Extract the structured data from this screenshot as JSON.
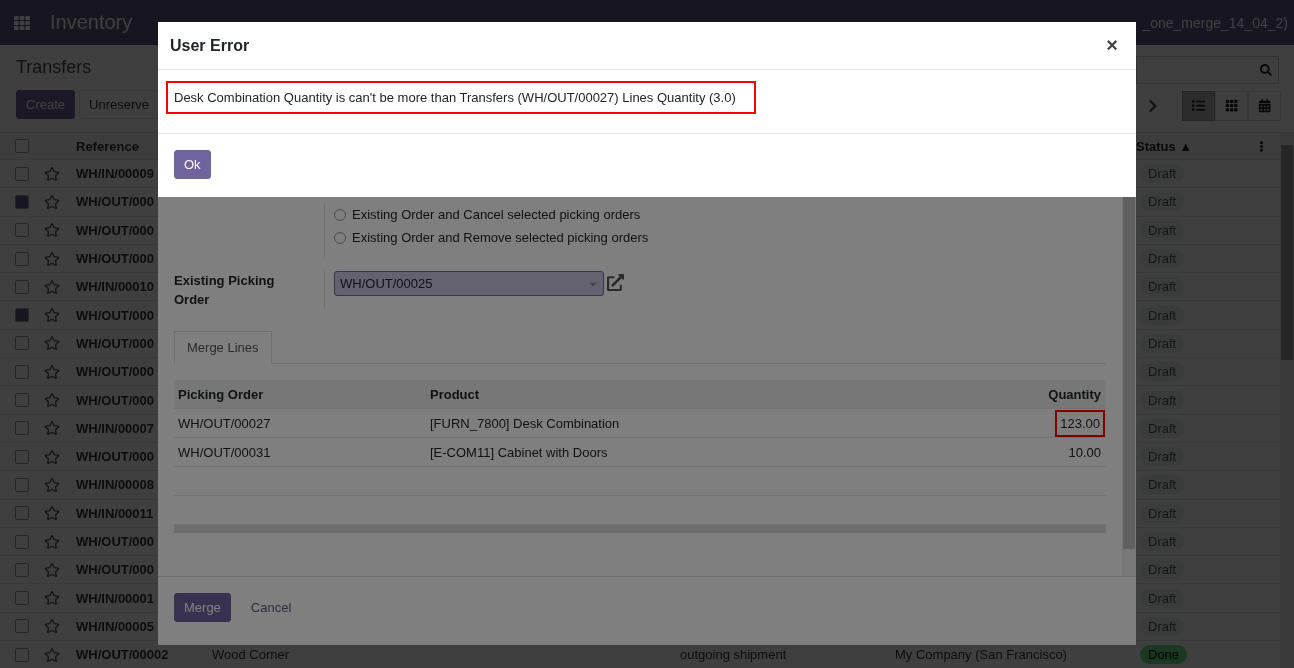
{
  "navbar": {
    "app": "Inventory",
    "user": "_one_merge_14_04_2)"
  },
  "control_panel": {
    "title": "Transfers",
    "buttons": [
      {
        "label": "Create",
        "primary": true
      },
      {
        "label": "Unreserve",
        "primary": false
      }
    ],
    "views": [
      {
        "kind": "list",
        "selected": true
      },
      {
        "kind": "kanban",
        "selected": false
      },
      {
        "kind": "calendar",
        "selected": false
      }
    ]
  },
  "list": {
    "all_checked": false,
    "columns": [
      "Reference",
      "Status ▲"
    ],
    "rows": [
      {
        "reference": "WH/IN/00009",
        "checked": false,
        "status": "Draft",
        "done": false
      },
      {
        "reference": "WH/OUT/000",
        "checked": true,
        "status": "Draft",
        "done": false
      },
      {
        "reference": "WH/OUT/000",
        "checked": false,
        "status": "Draft",
        "done": false
      },
      {
        "reference": "WH/OUT/000",
        "checked": false,
        "status": "Draft",
        "done": false
      },
      {
        "reference": "WH/IN/00010",
        "checked": false,
        "status": "Draft",
        "done": false
      },
      {
        "reference": "WH/OUT/000",
        "checked": true,
        "status": "Draft",
        "done": false
      },
      {
        "reference": "WH/OUT/000",
        "checked": false,
        "status": "Draft",
        "done": false
      },
      {
        "reference": "WH/OUT/000",
        "checked": false,
        "status": "Draft",
        "done": false
      },
      {
        "reference": "WH/OUT/000",
        "checked": false,
        "status": "Draft",
        "done": false
      },
      {
        "reference": "WH/IN/00007",
        "checked": false,
        "status": "Draft",
        "done": false
      },
      {
        "reference": "WH/OUT/000",
        "checked": false,
        "status": "Draft",
        "done": false
      },
      {
        "reference": "WH/IN/00008",
        "checked": false,
        "status": "Draft",
        "done": false
      },
      {
        "reference": "WH/IN/00011",
        "checked": false,
        "status": "Draft",
        "done": false
      },
      {
        "reference": "WH/OUT/000",
        "checked": false,
        "status": "Draft",
        "done": false
      },
      {
        "reference": "WH/OUT/000",
        "checked": false,
        "status": "Draft",
        "done": false
      },
      {
        "reference": "WH/IN/00001",
        "checked": false,
        "status": "Draft",
        "done": false
      },
      {
        "reference": "WH/IN/00005",
        "checked": false,
        "status": "Draft",
        "done": false
      },
      {
        "reference": "WH/OUT/00002",
        "contact": "Wood Corner",
        "operation": "outgoing shipment",
        "company": "My Company (San Francisco)",
        "checked": false,
        "status": "Done",
        "done": true
      }
    ]
  },
  "wizard": {
    "options": [
      {
        "label": "Existing Order and Cancel selected picking orders",
        "selected": false
      },
      {
        "label": "Existing Order and Remove selected picking orders",
        "selected": false
      }
    ],
    "field_label": "Existing Picking Order",
    "field_value": "WH/OUT/00025",
    "tabs": [
      {
        "label": "Merge Lines",
        "selected": true
      }
    ],
    "table": {
      "columns": [
        "Picking Order",
        "Product",
        "Quantity"
      ],
      "rows": [
        {
          "picking_order": "WH/OUT/00027",
          "product": "[FURN_7800] Desk Combination",
          "quantity": "123.00",
          "highlighted": true
        },
        {
          "picking_order": "WH/OUT/00031",
          "product": "[E-COM11] Cabinet with Doors",
          "quantity": "10.00",
          "highlighted": false
        }
      ]
    },
    "buttons": [
      "Merge",
      "Cancel"
    ]
  },
  "error_dialog": {
    "title": "User Error",
    "close": "×",
    "message": "Desk Combination Quantity is can't be more than Transfers (WH/OUT/00027) Lines Quantity (3.0)",
    "highlighted": true,
    "button": "Ok"
  }
}
